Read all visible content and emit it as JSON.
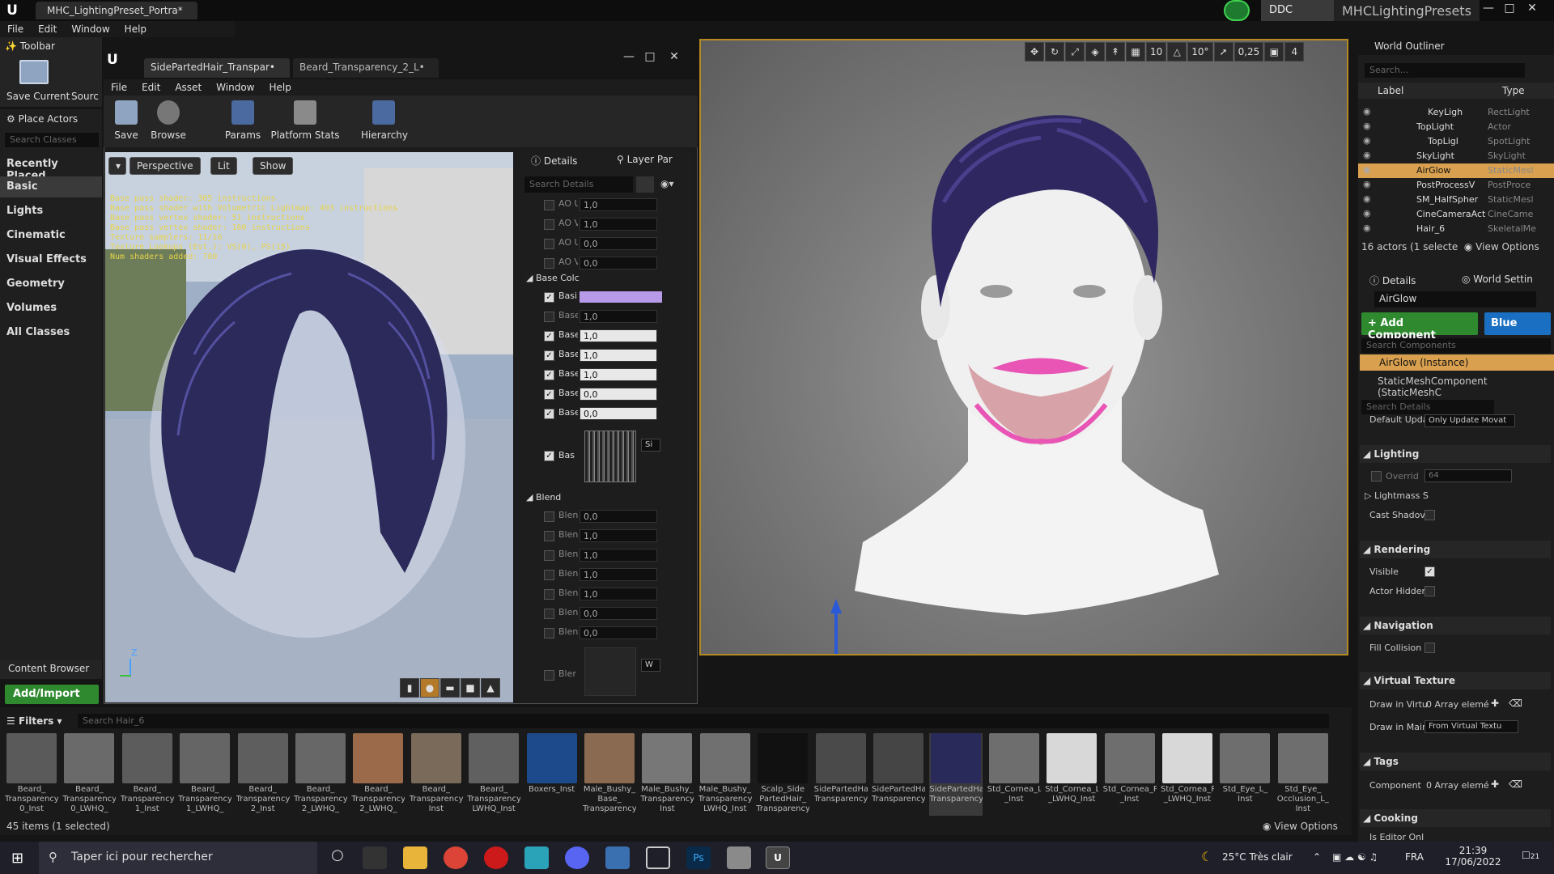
{
  "app": {
    "doc_tab": "MHC_LightingPreset_Portra*",
    "badge_label": "DDC",
    "project_name": "MHCLightingPresets",
    "menu": [
      "File",
      "Edit",
      "Window",
      "Help"
    ]
  },
  "left_toolbar": {
    "title": "Toolbar",
    "save_label": "Save Current",
    "source_label": "Sourc"
  },
  "place_actors": {
    "title": "Place Actors",
    "search_placeholder": "Search Classes",
    "categories": [
      "Recently Placed",
      "Basic",
      "Lights",
      "Cinematic",
      "Visual Effects",
      "Geometry",
      "Volumes",
      "All Classes"
    ],
    "selected": "Basic"
  },
  "content_browser": {
    "title": "Content Browser",
    "add_import": "Add/Import",
    "filters": "Filters",
    "search_placeholder": "Search Hair_6",
    "count": "45 items (1 selected)",
    "view_options": "View Options",
    "assets": [
      {
        "label": "Beard_ Transparency_ 0_Inst",
        "color": "#5a5a5a"
      },
      {
        "label": "Beard_ Transparency_ 0_LWHQ_",
        "color": "#6a6a6a"
      },
      {
        "label": "Beard_ Transparency_ 1_Inst",
        "color": "#5c5c5c"
      },
      {
        "label": "Beard_ Transparency_ 1_LWHQ_",
        "color": "#656565"
      },
      {
        "label": "Beard_ Transparency_ 2_Inst",
        "color": "#5e5e5e"
      },
      {
        "label": "Beard_ Transparency_ 2_LWHQ_",
        "color": "#676767"
      },
      {
        "label": "Beard_ Transparency_ 2_LWHQ_",
        "color": "#9a6a4a"
      },
      {
        "label": "Beard_ Transparency_ Inst",
        "color": "#7a6a5a"
      },
      {
        "label": "Beard_ Transparency_ LWHQ_Inst",
        "color": "#606060"
      },
      {
        "label": "Boxers_Inst",
        "color": "#1c4a8a"
      },
      {
        "label": "Male_Bushy_ Base_ Transparency",
        "color": "#8a6a50"
      },
      {
        "label": "Male_Bushy_ Transparency_ Inst",
        "color": "#777777"
      },
      {
        "label": "Male_Bushy_ Transparency_ LWHQ_Inst",
        "color": "#707070"
      },
      {
        "label": "Scalp_Side PartedHair_ Transparency",
        "color": "#111111"
      },
      {
        "label": "SidePartedHair_ Transparency",
        "color": "#4a4a4a"
      },
      {
        "label": "SidePartedHair_ Transparency",
        "color": "#454545"
      },
      {
        "label": "SidePartedHair_ Transparency",
        "color": "#2a2a5a"
      },
      {
        "label": "Std_Cornea_L _Inst",
        "color": "#6e6e6e"
      },
      {
        "label": "Std_Cornea_L _LWHQ_Inst",
        "color": "#d8d8d8"
      },
      {
        "label": "Std_Cornea_R _Inst",
        "color": "#6e6e6e"
      },
      {
        "label": "Std_Cornea_R _LWHQ_Inst",
        "color": "#d8d8d8"
      },
      {
        "label": "Std_Eye_L_ Inst",
        "color": "#6e6e6e"
      },
      {
        "label": "Std_Eye_ Occlusion_L_ Inst",
        "color": "#6e6e6e"
      }
    ],
    "selected_index": 16
  },
  "material_editor": {
    "tabs": [
      "SidePartedHair_Transpar•",
      "Beard_Transparency_2_L•"
    ],
    "menu": [
      "File",
      "Edit",
      "Asset",
      "Window",
      "Help"
    ],
    "tools": [
      "Save",
      "Browse",
      "Params",
      "Platform Stats",
      "Hierarchy"
    ],
    "viewport_buttons": [
      "Perspective",
      "Lit",
      "Show"
    ],
    "stats": [
      "Base pass shader: 305 instructions",
      "Base pass shader with Volumetric Lightmap: 493 instructions",
      "Base pass vertex shader: 51 instructions",
      "Base pass vertex shader: 160 instructions",
      "Texture samplers: 11/16",
      "Texture Lookups (Est.): VS(0), PS(15)",
      "Num shaders added: 700"
    ],
    "axis_z": "Z",
    "details_tabs": [
      "Details",
      "Layer Par"
    ],
    "details_search": "Search Details",
    "ao_rows": [
      {
        "label": "AO U",
        "value": "1,0"
      },
      {
        "label": "AO V",
        "value": "1,0"
      },
      {
        "label": "AO U",
        "value": "0,0"
      },
      {
        "label": "AO V",
        "value": "0,0"
      }
    ],
    "base_color_section": "Base Colc",
    "base_rows": [
      {
        "label": "Basi",
        "value": "",
        "checked": true,
        "swatch": "#b79ae8"
      },
      {
        "label": "Base",
        "value": "1,0",
        "checked": false
      },
      {
        "label": "Base",
        "value": "1,0",
        "checked": true
      },
      {
        "label": "Base",
        "value": "1,0",
        "checked": true
      },
      {
        "label": "Base",
        "value": "1,0",
        "checked": true
      },
      {
        "label": "Base",
        "value": "0,0",
        "checked": true
      },
      {
        "label": "Base",
        "value": "0,0",
        "checked": true
      }
    ],
    "tex_row": {
      "label": "Bas",
      "dropdown": "Si"
    },
    "blend_section": "Blend",
    "blend_rows": [
      {
        "label": "Blen",
        "value": "0,0"
      },
      {
        "label": "Blen",
        "value": "1,0"
      },
      {
        "label": "Blen",
        "value": "1,0"
      },
      {
        "label": "Blen",
        "value": "1,0"
      },
      {
        "label": "Blen",
        "value": "1,0"
      },
      {
        "label": "Blen",
        "value": "0,0"
      },
      {
        "label": "Blen",
        "value": "0,0"
      }
    ],
    "blend_tex": {
      "label": "Bler",
      "dropdown": "W"
    }
  },
  "main_viewport": {
    "snap_values": [
      "10",
      "10°",
      "0,25",
      "4"
    ]
  },
  "outliner": {
    "title": "World Outliner",
    "search_placeholder": "Search...",
    "col_label": "Label",
    "col_type": "Type",
    "rows": [
      {
        "name": "KeyLigh",
        "type": "RectLight",
        "indent": 1
      },
      {
        "name": "TopLight",
        "type": "Actor",
        "indent": 0
      },
      {
        "name": "TopLigl",
        "type": "SpotLight",
        "indent": 1
      },
      {
        "name": "SkyLight",
        "type": "SkyLight",
        "indent": 0
      },
      {
        "name": "AirGlow",
        "type": "StaticMesl",
        "indent": 0,
        "selected": true
      },
      {
        "name": "PostProcessV",
        "type": "PostProce",
        "indent": 0
      },
      {
        "name": "SM_HalfSpher",
        "type": "StaticMesl",
        "indent": 0
      },
      {
        "name": "CineCameraAct",
        "type": "CineCame",
        "indent": 0
      },
      {
        "name": "Hair_6",
        "type": "SkeletalMe",
        "indent": 0
      }
    ],
    "footer": "16 actors (1 selecte",
    "view_options": "View Options"
  },
  "details": {
    "tabs": [
      "Details",
      "World Settin"
    ],
    "name": "AirGlow",
    "add_component": "+ Add Component",
    "blueprint": "Blue",
    "search_components": "Search Components",
    "instance": "AirGlow (Instance)",
    "component": "StaticMeshComponent (StaticMeshC",
    "search_details": "Search Details",
    "default_update_label": "Default Upda",
    "default_update_value": "Only Update Movat",
    "categories": {
      "lighting": "Lighting",
      "rendering": "Rendering",
      "navigation": "Navigation",
      "virtual_texture": "Virtual Texture",
      "tags": "Tags",
      "cooking": "Cooking"
    },
    "override_label": "Overrid",
    "override_value": "64",
    "lightmass_label": "Lightmass S",
    "cast_shadow_label": "Cast Shadov",
    "visible_label": "Visible",
    "actor_hidden_label": "Actor Hidder",
    "fill_collision_label": "Fill Collision",
    "draw_virtual_label": "Draw in Virtu",
    "draw_virtual_value": "0 Array elemé",
    "draw_main_label": "Draw in Mair",
    "draw_main_value": "From Virtual Textu",
    "component_tags_label": "Component",
    "component_tags_value": "0 Array elemé",
    "editor_only_label": "Is Editor Onl"
  },
  "taskbar": {
    "search": "Taper ici pour rechercher",
    "weather": "25°C  Très clair",
    "lang": "FRA",
    "time": "21:39",
    "date": "17/06/2022",
    "notif": "21"
  }
}
